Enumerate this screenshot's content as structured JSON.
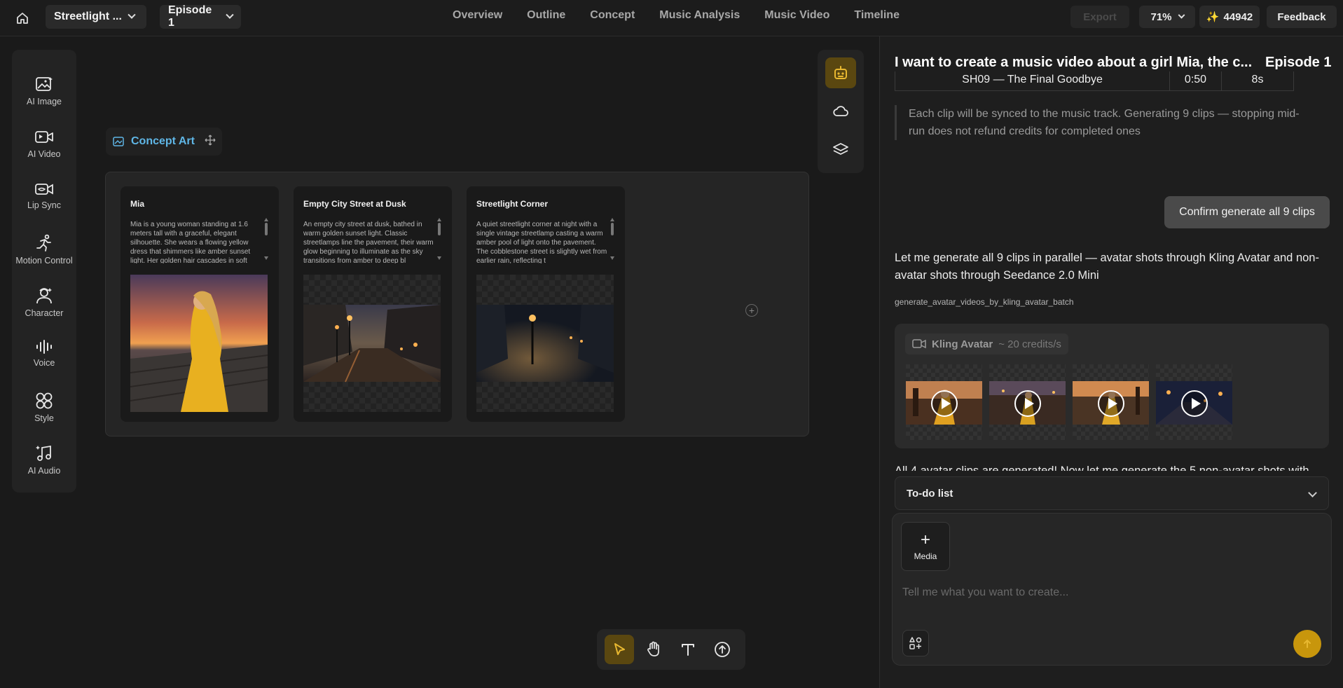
{
  "topbar": {
    "project": "Streetlight ...",
    "episode": "Episode 1",
    "nav": [
      "Overview",
      "Outline",
      "Concept",
      "Music Analysis",
      "Music Video",
      "Timeline"
    ],
    "export_label": "Export",
    "zoom": "71%",
    "credits": "44942",
    "feedback_label": "Feedback"
  },
  "toolbox": {
    "items": [
      {
        "label": "AI Image",
        "icon": "image-icon"
      },
      {
        "label": "AI Video",
        "icon": "video-icon"
      },
      {
        "label": "Lip Sync",
        "icon": "lip-sync-icon"
      },
      {
        "label": "Motion Control",
        "icon": "motion-icon"
      },
      {
        "label": "Character",
        "icon": "character-icon"
      },
      {
        "label": "Voice",
        "icon": "voice-icon"
      },
      {
        "label": "Style",
        "icon": "style-icon"
      },
      {
        "label": "AI Audio",
        "icon": "audio-icon"
      }
    ]
  },
  "canvas": {
    "group_label": "Concept Art",
    "cards": [
      {
        "title": "Mia",
        "desc": "Mia is a young woman standing at 1.6 meters tall with a graceful, elegant silhouette. She wears a flowing yellow dress that shimmers like amber sunset light. Her golden hair cascades in soft"
      },
      {
        "title": "Empty City Street at Dusk",
        "desc": "An empty city street at dusk, bathed in warm golden sunset light. Classic streetlamps line the pavement, their warm glow beginning to illuminate as the sky transitions from amber to deep bl"
      },
      {
        "title": "Streetlight Corner",
        "desc": "A quiet streetlight corner at night with a single vintage streetlamp casting a warm amber pool of light onto the pavement. The cobblestone street is slightly wet from earlier rain, reflecting t"
      }
    ]
  },
  "chat": {
    "title": "I want to create a music video about a girl Mia, the c...",
    "episode": "Episode 1",
    "table_row": {
      "shot": "SH09 — The Final Goodbye",
      "time": "0:50",
      "duration": "8s"
    },
    "note": "Each clip will be synced to the music track. Generating 9 clips — stopping mid-run does not refund credits for completed ones",
    "confirm_label": "Confirm generate all 9 clips",
    "message": "Let me generate all 9 clips in parallel — avatar shots through Kling Avatar and non-avatar shots through Seedance 2.0 Mini",
    "function_name": "generate_avatar_videos_by_kling_avatar_batch",
    "kling": {
      "name": "Kling Avatar",
      "credits": "~ 20 credits/s"
    },
    "cut_message": "All 4 avatar clips are generated! Now let me generate the 5 non-avatar shots with",
    "todo_label": "To-do list",
    "media_label": "Media",
    "input_placeholder": "Tell me what you want to create..."
  },
  "colors": {
    "accent": "#c8960c",
    "link": "#5fb6e6"
  }
}
